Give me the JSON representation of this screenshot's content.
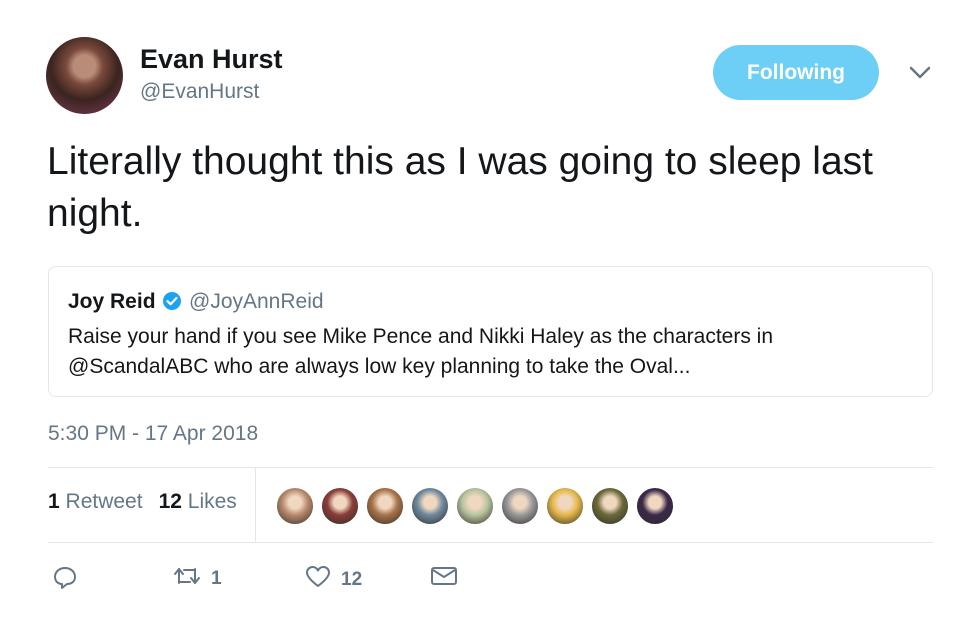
{
  "author": {
    "name": "Evan Hurst",
    "handle": "@EvanHurst"
  },
  "follow_button": {
    "label": "Following",
    "color": "#6ecff6"
  },
  "tweet": {
    "text": "Literally thought this as I was going to sleep last night."
  },
  "quoted": {
    "name": "Joy Reid",
    "handle": "@JoyAnnReid",
    "verified": true,
    "text": "Raise your hand if you see Mike Pence and Nikki Haley as the characters in @ScandalABC who are always low key planning to take the Oval..."
  },
  "timestamp": "5:30 PM - 17 Apr 2018",
  "stats": {
    "retweet_count": "1",
    "retweet_label": "Retweet",
    "like_count": "12",
    "like_label": "Likes"
  },
  "likers": [
    {
      "icon": "liker-avatar",
      "color": "#b98a6e"
    },
    {
      "icon": "liker-avatar",
      "color": "#8a3e3a"
    },
    {
      "icon": "liker-avatar",
      "color": "#a8744a"
    },
    {
      "icon": "liker-avatar",
      "color": "#6f8a9e"
    },
    {
      "icon": "liker-avatar",
      "color": "#b8c4a0"
    },
    {
      "icon": "liker-avatar",
      "color": "#9a9a9a"
    },
    {
      "icon": "liker-avatar",
      "color": "#e6b84a"
    },
    {
      "icon": "liker-avatar",
      "color": "#6b6a3a"
    },
    {
      "icon": "liker-avatar",
      "color": "#3a2a4a"
    }
  ],
  "actions": {
    "reply": {
      "icon": "reply-icon",
      "count": ""
    },
    "retweet": {
      "icon": "retweet-icon",
      "count": "1"
    },
    "like": {
      "icon": "heart-icon",
      "count": "12"
    },
    "message": {
      "icon": "envelope-icon",
      "count": ""
    }
  }
}
